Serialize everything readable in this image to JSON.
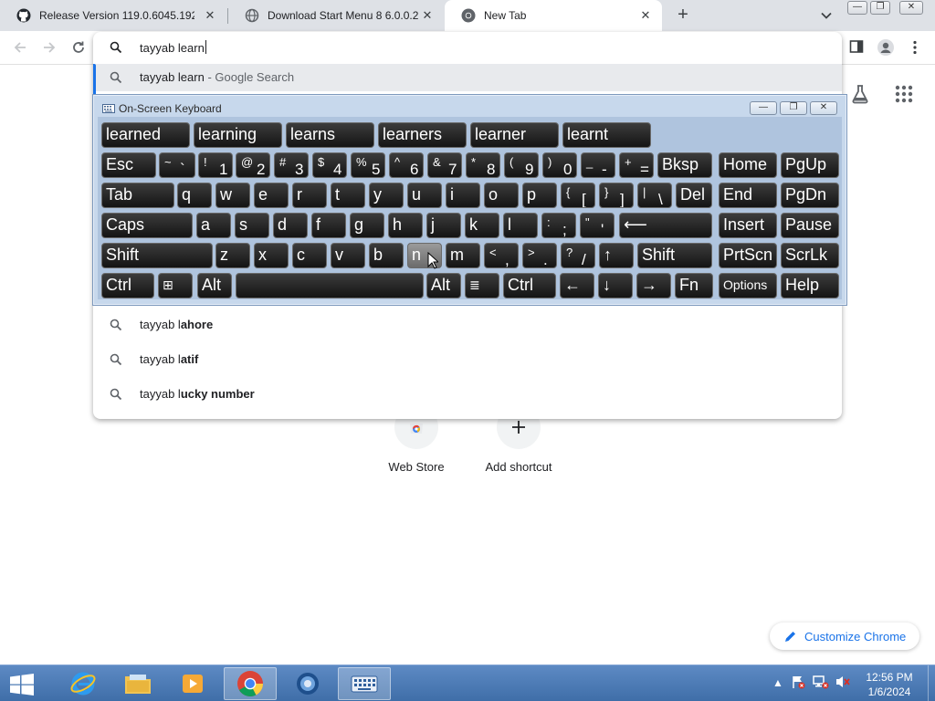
{
  "browser": {
    "tabs": [
      {
        "title": "Release Version 119.0.6045.192 ·",
        "icon": "github-icon",
        "active": false
      },
      {
        "title": "Download Start Menu 8 6.0.0.2",
        "icon": "globe-icon",
        "active": false
      },
      {
        "title": "New Tab",
        "icon": "chrome-icon",
        "active": true
      }
    ],
    "omnibox": {
      "value": "tayyab learn",
      "suggestions": [
        {
          "prefix": "tayyab learn",
          "suffix": " - Google Search",
          "bold": "",
          "selected": true
        },
        {
          "prefix": "tayyab l",
          "suffix": "",
          "bold": "ahore",
          "selected": false
        },
        {
          "prefix": "tayyab l",
          "suffix": "",
          "bold": "atif",
          "selected": false
        },
        {
          "prefix": "tayyab l",
          "suffix": "",
          "bold": "ucky number",
          "selected": false
        }
      ]
    }
  },
  "newtab": {
    "shortcuts": [
      {
        "label": "Web Store",
        "icon": "web-store-icon"
      },
      {
        "label": "Add shortcut",
        "icon": "plus-icon"
      }
    ],
    "customize_label": "Customize Chrome"
  },
  "osk": {
    "title": "On-Screen Keyboard",
    "predictions": [
      "learned",
      "learning",
      "learns",
      "learners",
      "learner",
      "learnt"
    ],
    "pressed_key": "n",
    "rows": {
      "row1": [
        {
          "main": "Esc"
        },
        {
          "sub": "~",
          "main": "`"
        },
        {
          "sub": "!",
          "main": "1"
        },
        {
          "sub": "@",
          "main": "2"
        },
        {
          "sub": "#",
          "main": "3"
        },
        {
          "sub": "$",
          "main": "4"
        },
        {
          "sub": "%",
          "main": "5"
        },
        {
          "sub": "^",
          "main": "6"
        },
        {
          "sub": "&",
          "main": "7"
        },
        {
          "sub": "*",
          "main": "8"
        },
        {
          "sub": "(",
          "main": "9"
        },
        {
          "sub": ")",
          "main": "0"
        },
        {
          "sub": "_",
          "main": "-"
        },
        {
          "sub": "+",
          "main": "="
        },
        {
          "main": "Bksp"
        }
      ],
      "row2": [
        {
          "main": "Tab"
        },
        {
          "main": "q"
        },
        {
          "main": "w"
        },
        {
          "main": "e"
        },
        {
          "main": "r"
        },
        {
          "main": "t"
        },
        {
          "main": "y"
        },
        {
          "main": "u"
        },
        {
          "main": "i"
        },
        {
          "main": "o"
        },
        {
          "main": "p"
        },
        {
          "sub": "{",
          "main": "["
        },
        {
          "sub": "}",
          "main": "]"
        },
        {
          "sub": "|",
          "main": "\\"
        },
        {
          "main": "Del"
        }
      ],
      "row3": [
        {
          "main": "Caps"
        },
        {
          "main": "a"
        },
        {
          "main": "s"
        },
        {
          "main": "d"
        },
        {
          "main": "f"
        },
        {
          "main": "g"
        },
        {
          "main": "h"
        },
        {
          "main": "j"
        },
        {
          "main": "k"
        },
        {
          "main": "l"
        },
        {
          "sub": ":",
          "main": ";"
        },
        {
          "sub": "\"",
          "main": "'"
        },
        {
          "main": "⟵"
        }
      ],
      "row4": [
        {
          "main": "Shift"
        },
        {
          "main": "z"
        },
        {
          "main": "x"
        },
        {
          "main": "c"
        },
        {
          "main": "v"
        },
        {
          "main": "b"
        },
        {
          "main": "n"
        },
        {
          "main": "m"
        },
        {
          "sub": "<",
          "main": ","
        },
        {
          "sub": ">",
          "main": "."
        },
        {
          "sub": "?",
          "main": "/"
        },
        {
          "main": "↑"
        },
        {
          "main": "Shift"
        }
      ],
      "row5": [
        {
          "main": "Ctrl"
        },
        {
          "main": "⊞"
        },
        {
          "main": "Alt"
        },
        {
          "main": ""
        },
        {
          "main": "Alt"
        },
        {
          "main": "≣"
        },
        {
          "main": "Ctrl"
        },
        {
          "main": "←"
        },
        {
          "main": "↓"
        },
        {
          "main": "→"
        },
        {
          "main": "Fn"
        }
      ],
      "side": [
        [
          "Home",
          "PgUp"
        ],
        [
          "End",
          "PgDn"
        ],
        [
          "Insert",
          "Pause"
        ],
        [
          "PrtScn",
          "ScrLk"
        ],
        [
          "Options",
          "Help"
        ]
      ]
    }
  },
  "taskbar": {
    "apps": [
      "internet-explorer-icon",
      "file-explorer-icon",
      "media-player-icon",
      "chrome-icon",
      "generic-app-icon",
      "on-screen-keyboard-icon"
    ],
    "time": "12:56 PM",
    "date": "1/6/2024"
  },
  "colors": {
    "accent": "#1a73e8",
    "tabstrip": "#dee1e6",
    "osk_bg": "#c7d8ec",
    "key_bg": "#1e1e1e",
    "taskbar": "#4a79b8"
  }
}
